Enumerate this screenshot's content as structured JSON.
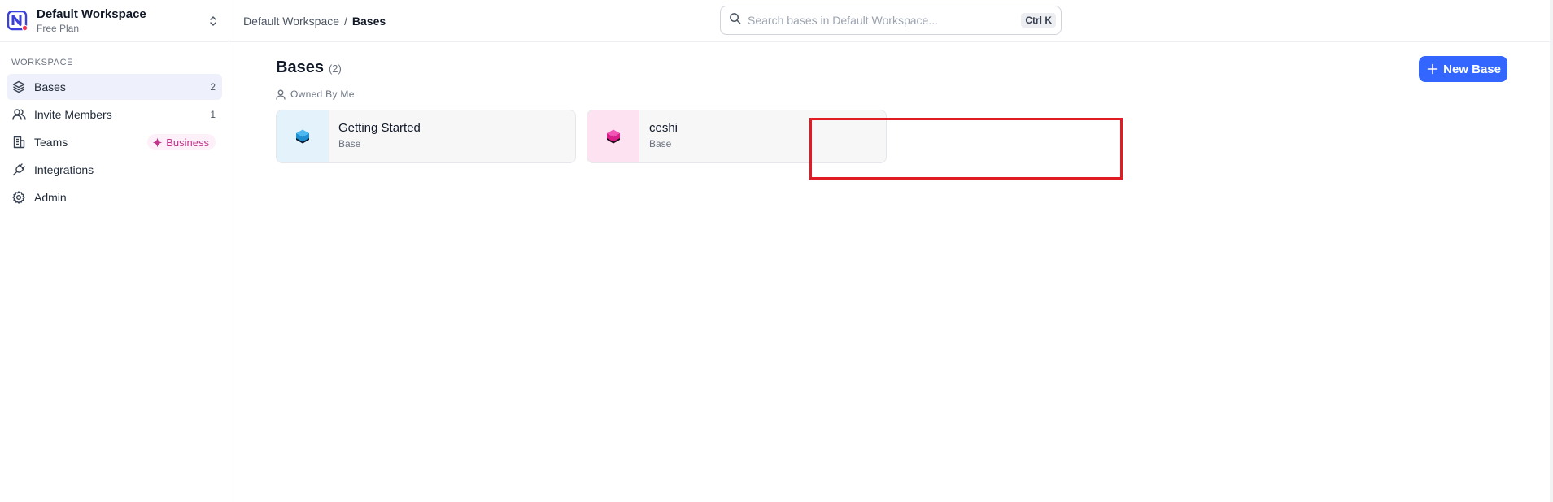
{
  "workspace": {
    "name": "Default Workspace",
    "plan": "Free Plan"
  },
  "sidebar": {
    "section_label": "WORKSPACE",
    "items": [
      {
        "label": "Bases",
        "count": "2",
        "icon": "layers-icon"
      },
      {
        "label": "Invite Members",
        "count": "1",
        "icon": "users-icon"
      },
      {
        "label": "Teams",
        "badge": "Business",
        "icon": "building-icon"
      },
      {
        "label": "Integrations",
        "icon": "plug-icon"
      },
      {
        "label": "Admin",
        "icon": "gear-icon"
      }
    ]
  },
  "topbar": {
    "breadcrumb": [
      "Default Workspace",
      "/",
      "Bases"
    ],
    "search_placeholder": "Search bases in Default Workspace...",
    "search_shortcut": "Ctrl K"
  },
  "main": {
    "title": "Bases",
    "count": "(2)",
    "owned_label": "Owned By Me",
    "new_base_label": "New Base",
    "cards": [
      {
        "name": "Getting Started",
        "type": "Base",
        "color": "#29a3e3",
        "bg": "#e3f2fb"
      },
      {
        "name": "ceshi",
        "type": "Base",
        "color": "#e2339a",
        "bg": "#fde3f2"
      }
    ]
  },
  "colors": {
    "accent": "#3366ff",
    "highlight": "#e01b24",
    "business": "#c2338b"
  }
}
